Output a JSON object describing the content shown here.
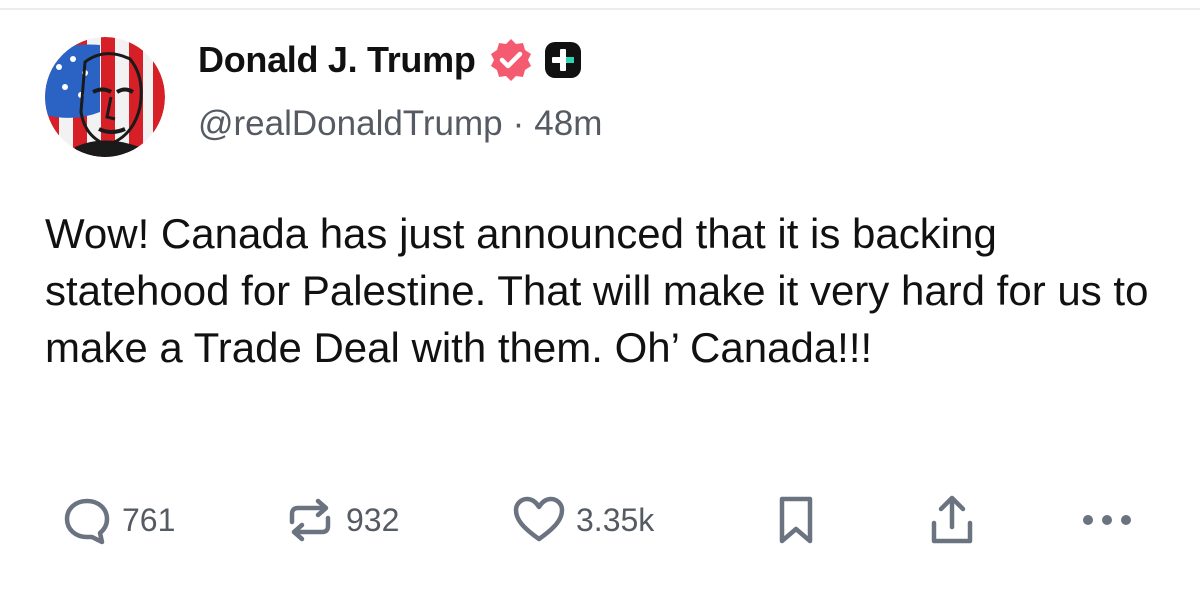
{
  "post": {
    "author": {
      "display_name": "Donald J. Trump",
      "handle": "@realDonaldTrump",
      "separator": "·",
      "timestamp": "48m",
      "verified_badge_color": "#f45a70",
      "avatar_icon": "flag-portrait-avatar"
    },
    "text": "Wow! Canada has just announced that it is backing statehood for Palestine. That will make it very hard for us to make a Trade Deal with them. Oh’ Canada!!!",
    "actions": {
      "reply_count": "761",
      "repost_count": "932",
      "like_count": "3.35k"
    }
  },
  "colors": {
    "text": "#111111",
    "secondary": "#555a63",
    "icon": "#6b7280",
    "verified": "#f45a70"
  }
}
